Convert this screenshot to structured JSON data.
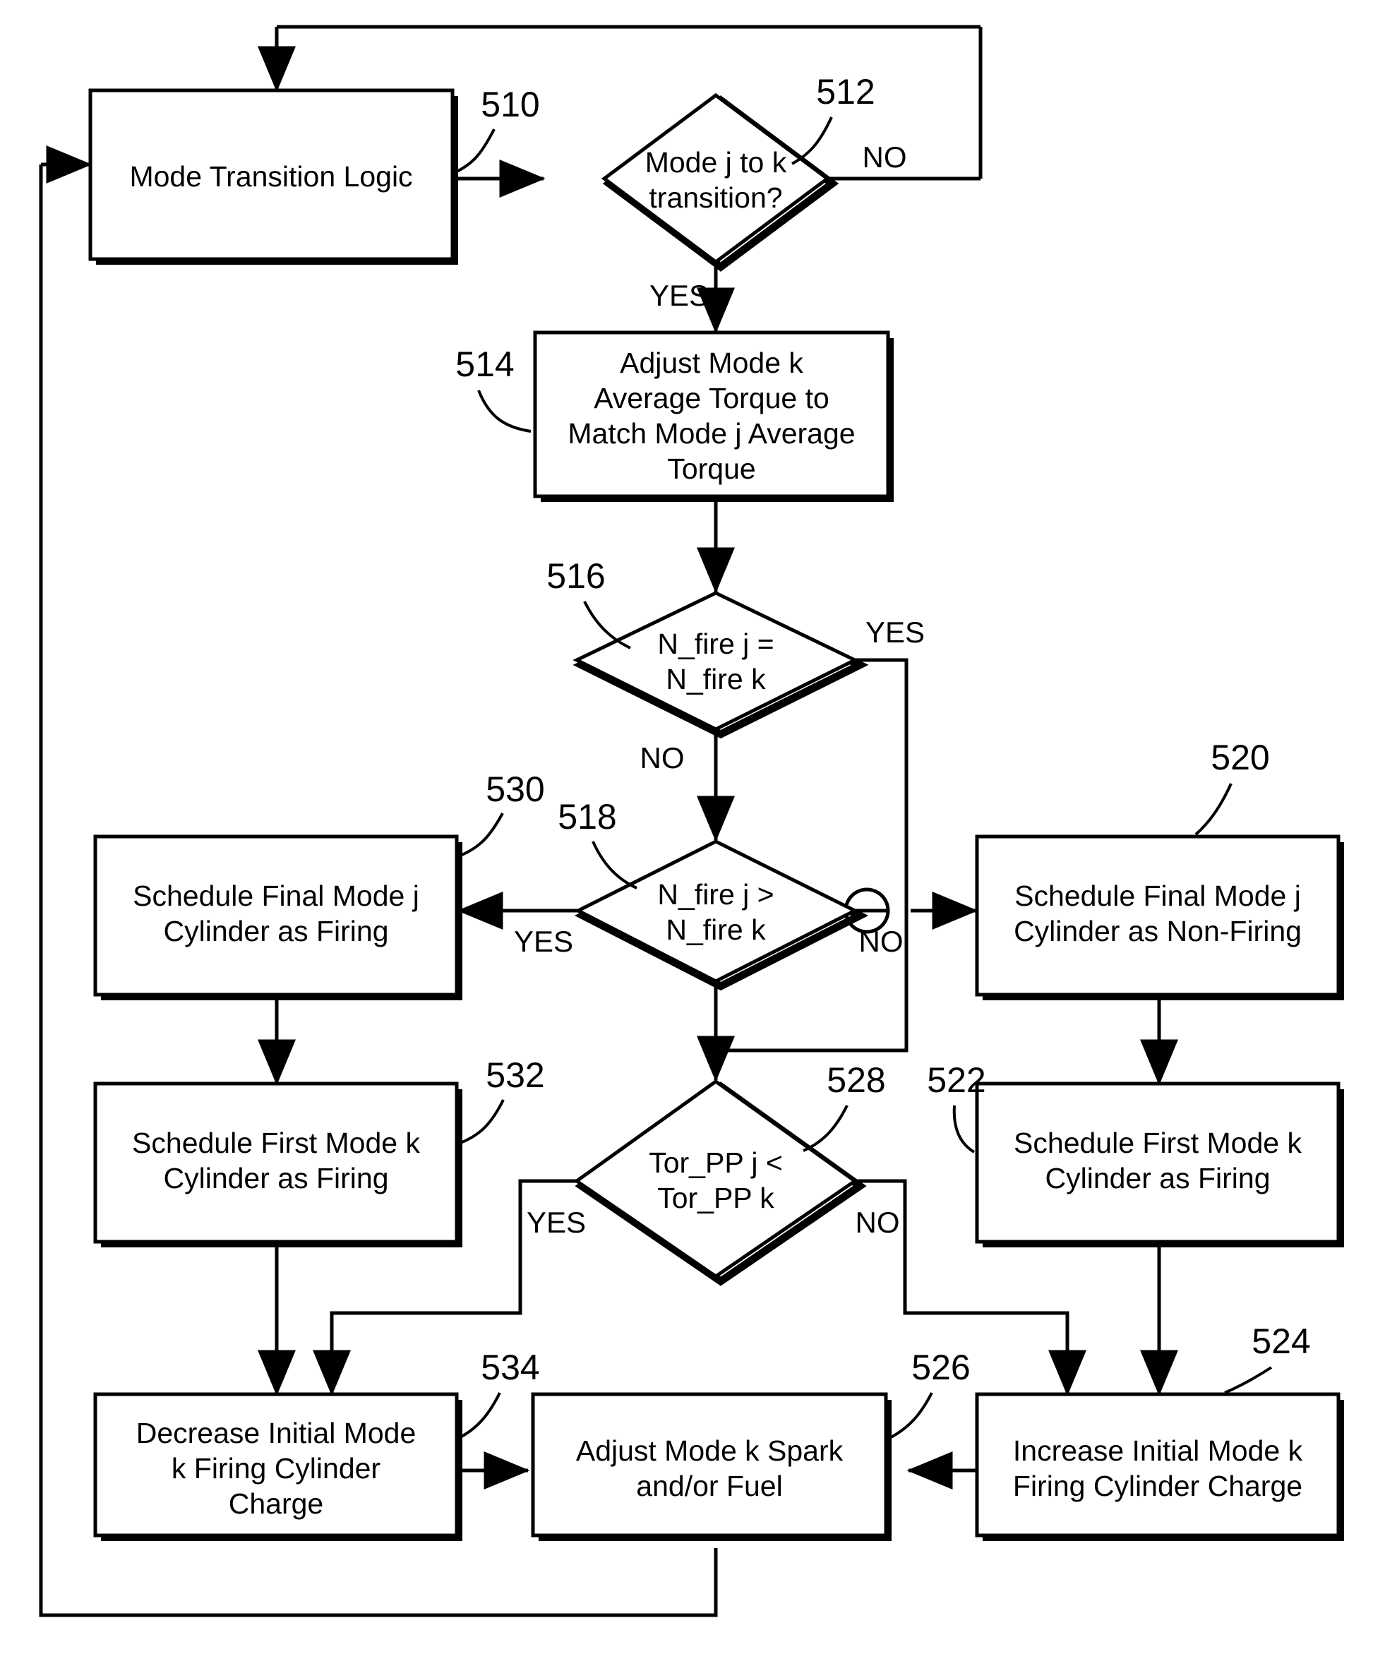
{
  "figure": {
    "title": "Mode Transition Logic Flowchart",
    "background_color": "#ffffff",
    "line_color": "#000000"
  },
  "nodes": {
    "n510": {
      "ref": "510",
      "shape": "process",
      "lines": [
        "Mode Transition Logic"
      ]
    },
    "n512": {
      "ref": "512",
      "shape": "decision",
      "lines": [
        "Mode j to k",
        "transition?"
      ],
      "yes_label": "YES",
      "no_label": "NO"
    },
    "n514": {
      "ref": "514",
      "shape": "process",
      "lines": [
        "Adjust Mode k",
        "Average Torque to",
        "Match Mode j Average",
        "Torque"
      ]
    },
    "n516": {
      "ref": "516",
      "shape": "decision",
      "lines": [
        "N_fire j =",
        "N_fire k"
      ],
      "yes_label": "YES",
      "no_label": "NO"
    },
    "n518": {
      "ref": "518",
      "shape": "decision",
      "lines": [
        "N_fire j >",
        "N_fire k"
      ],
      "yes_label": "YES",
      "no_label": "NO"
    },
    "n520": {
      "ref": "520",
      "shape": "process",
      "lines": [
        "Schedule Final Mode j",
        "Cylinder as Non-Firing"
      ]
    },
    "n522": {
      "ref": "522",
      "shape": "process",
      "lines": [
        "Schedule First Mode k",
        "Cylinder as Firing"
      ]
    },
    "n524": {
      "ref": "524",
      "shape": "process",
      "lines": [
        "Increase Initial Mode k",
        "Firing Cylinder Charge"
      ]
    },
    "n526": {
      "ref": "526",
      "shape": "process",
      "lines": [
        "Adjust Mode k Spark",
        "and/or Fuel"
      ]
    },
    "n528": {
      "ref": "528",
      "shape": "decision",
      "lines": [
        "Tor_PP j <",
        "Tor_PP k"
      ],
      "yes_label": "YES",
      "no_label": "NO"
    },
    "n530": {
      "ref": "530",
      "shape": "process",
      "lines": [
        "Schedule Final Mode j",
        "Cylinder as Firing"
      ]
    },
    "n532": {
      "ref": "532",
      "shape": "process",
      "lines": [
        "Schedule First Mode k",
        "Cylinder as Firing"
      ]
    },
    "n534": {
      "ref": "534",
      "shape": "process",
      "lines": [
        "Decrease Initial Mode",
        "k Firing Cylinder",
        "Charge"
      ]
    }
  },
  "edges": [
    {
      "from": "n510",
      "to": "n512",
      "label": ""
    },
    {
      "from": "n512",
      "to": "n510",
      "label": "NO"
    },
    {
      "from": "n512",
      "to": "n514",
      "label": "YES"
    },
    {
      "from": "n514",
      "to": "n516",
      "label": ""
    },
    {
      "from": "n516",
      "to": "n528",
      "label": "YES"
    },
    {
      "from": "n516",
      "to": "n518",
      "label": "NO"
    },
    {
      "from": "n518",
      "to": "n530",
      "label": "YES"
    },
    {
      "from": "n518",
      "to": "n520",
      "label": "NO"
    },
    {
      "from": "n520",
      "to": "n522",
      "label": ""
    },
    {
      "from": "n522",
      "to": "n524",
      "label": ""
    },
    {
      "from": "n524",
      "to": "n526",
      "label": ""
    },
    {
      "from": "n530",
      "to": "n532",
      "label": ""
    },
    {
      "from": "n532",
      "to": "n534",
      "label": ""
    },
    {
      "from": "n534",
      "to": "n526",
      "label": ""
    },
    {
      "from": "n528",
      "to": "n534",
      "label": "YES"
    },
    {
      "from": "n528",
      "to": "n524",
      "label": "NO"
    },
    {
      "from": "n526",
      "to": "n510",
      "label": ""
    }
  ]
}
